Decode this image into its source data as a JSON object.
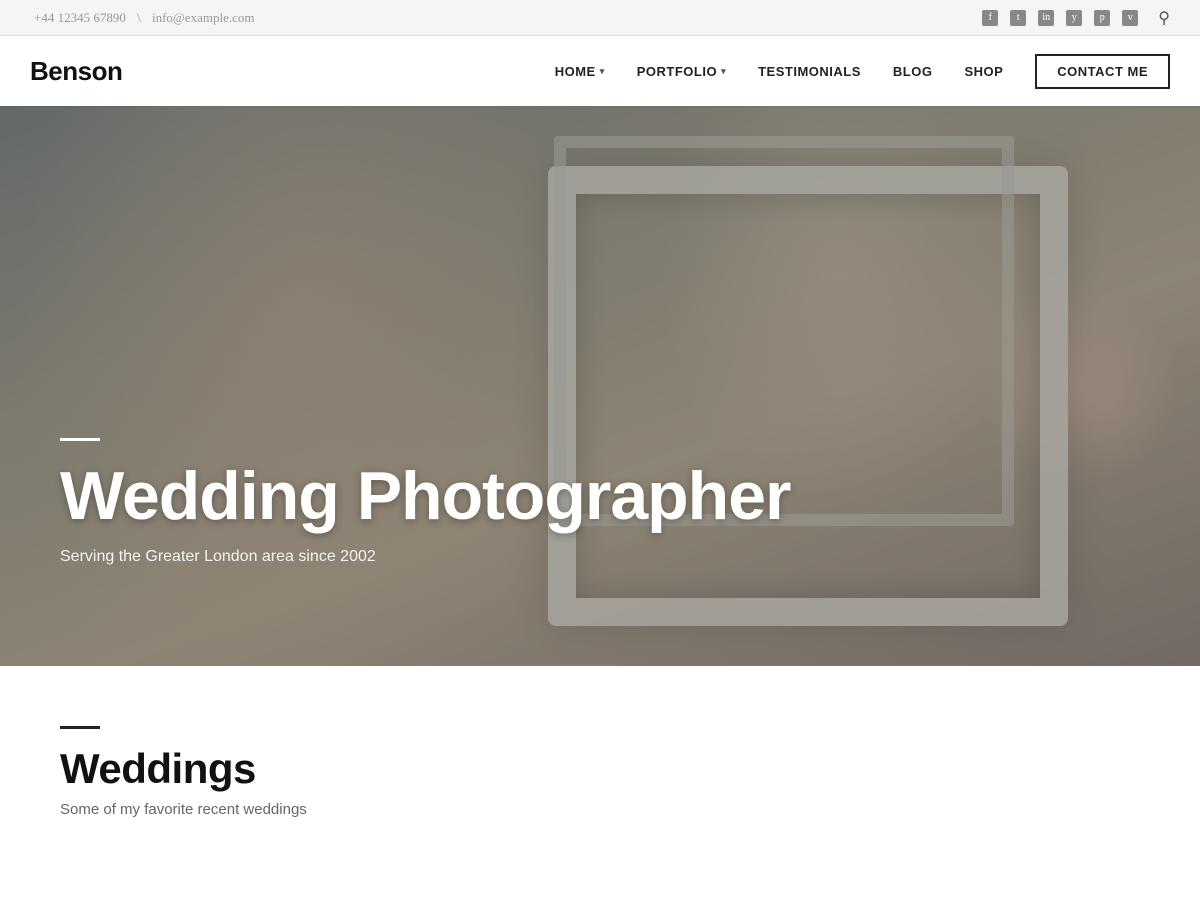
{
  "topbar": {
    "phone": "+44 12345 67890",
    "separator": "\\",
    "email": "info@example.com",
    "social_icons": [
      "f",
      "t",
      "i",
      "y",
      "p",
      "v"
    ]
  },
  "header": {
    "logo": "Benson",
    "nav": {
      "home_label": "HOME",
      "portfolio_label": "PORTFOLIO",
      "testimonials_label": "TESTIMONIALS",
      "blog_label": "BLOG",
      "shop_label": "SHOP",
      "contact_label": "CONTACT ME"
    }
  },
  "hero": {
    "line_accent": "",
    "title": "Wedding Photographer",
    "subtitle": "Serving the Greater London area since 2002"
  },
  "weddings_section": {
    "line_accent": "",
    "title": "Weddings",
    "subtitle": "Some of my favorite recent weddings"
  }
}
